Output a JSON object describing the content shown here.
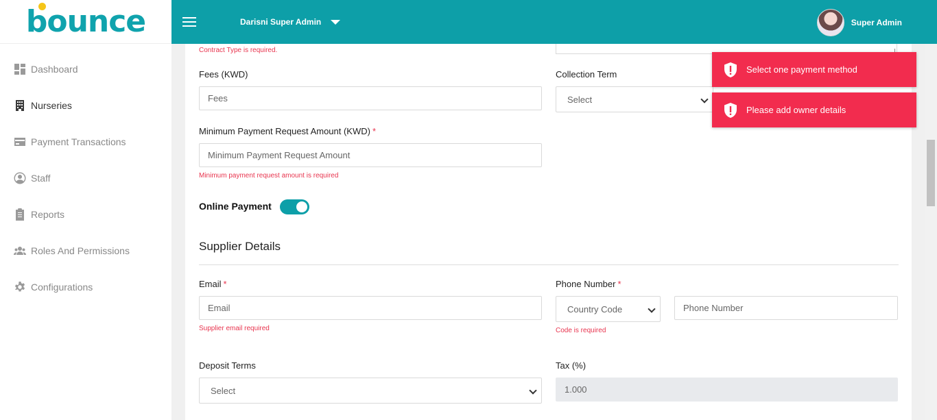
{
  "brand": {
    "logo_text": "bounce"
  },
  "header": {
    "tenant": "Darisni Super Admin",
    "user_name": "Super Admin"
  },
  "sidebar": {
    "items": [
      {
        "label": "Dashboard",
        "icon": "dashboard-icon"
      },
      {
        "label": "Nurseries",
        "icon": "building-icon"
      },
      {
        "label": "Payment Transactions",
        "icon": "credit-card-icon"
      },
      {
        "label": "Staff",
        "icon": "user-circle-icon"
      },
      {
        "label": "Reports",
        "icon": "clipboard-icon"
      },
      {
        "label": "Roles And Permissions",
        "icon": "users-group-icon"
      },
      {
        "label": "Configurations",
        "icon": "gear-icon"
      }
    ],
    "active": "Nurseries"
  },
  "form": {
    "contract_type_error": "Contract Type is required.",
    "fees_label": "Fees (KWD)",
    "fees_placeholder": "Fees",
    "collection_term_label": "Collection Term",
    "collection_term_value": "Select",
    "min_payment_label": "Minimum Payment Request Amount (KWD)",
    "min_payment_placeholder": "Minimum Payment Request Amount",
    "min_payment_error": "Minimum payment request amount is required",
    "online_payment_label": "Online Payment",
    "online_payment_on": true,
    "supplier_section": "Supplier Details",
    "email_label": "Email",
    "email_placeholder": "Email",
    "email_error": "Supplier email required",
    "phone_label": "Phone Number",
    "country_code_value": "Country Code",
    "country_code_error": "Code is required",
    "phone_placeholder": "Phone Number",
    "deposit_terms_label": "Deposit Terms",
    "deposit_terms_value": "Select",
    "tax_label": "Tax (%)",
    "tax_value": "1.000",
    "required_mark": "*"
  },
  "toasts": [
    {
      "message": "Select one payment method"
    },
    {
      "message": "Please add owner details"
    }
  ],
  "colors": {
    "brand": "#0d9fa8",
    "error": "#e8344e",
    "toast": "#f22c4e"
  }
}
